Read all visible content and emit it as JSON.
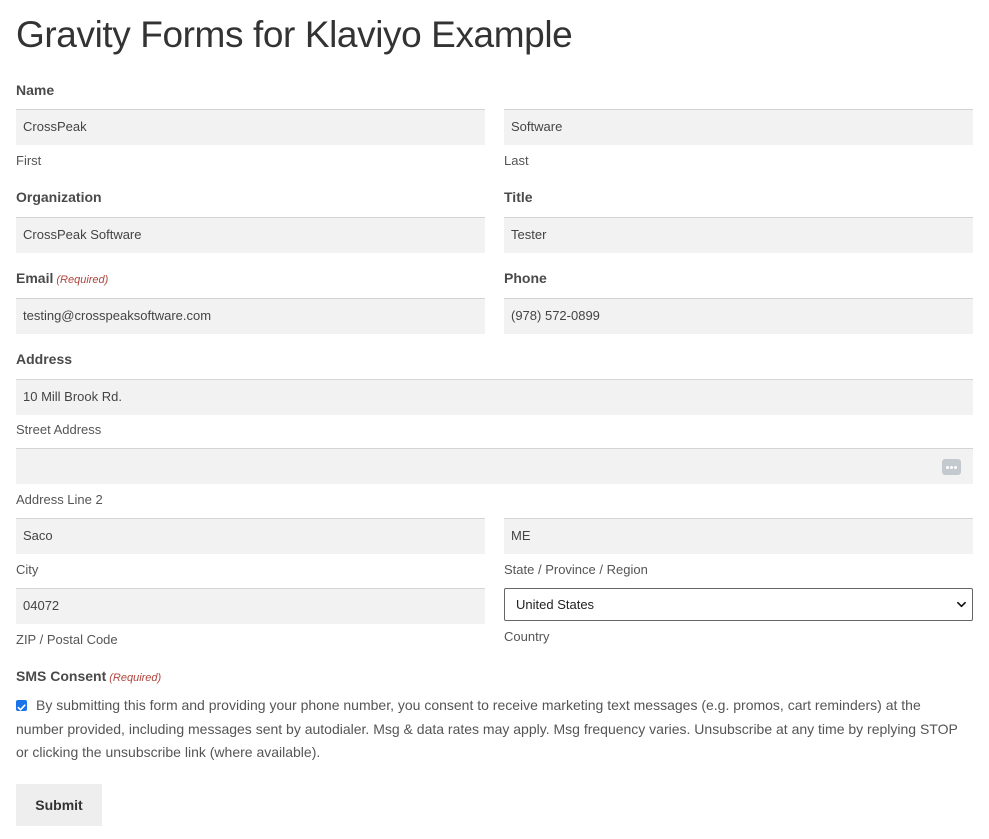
{
  "page": {
    "title": "Gravity Forms for Klaviyo Example"
  },
  "form": {
    "name": {
      "label": "Name",
      "first_value": "CrossPeak",
      "first_sublabel": "First",
      "last_value": "Software",
      "last_sublabel": "Last"
    },
    "organization": {
      "label": "Organization",
      "value": "CrossPeak Software"
    },
    "title_field": {
      "label": "Title",
      "value": "Tester"
    },
    "email": {
      "label": "Email",
      "required_text": "(Required)",
      "value": "testing@crosspeaksoftware.com"
    },
    "phone": {
      "label": "Phone",
      "value": "(978) 572-0899"
    },
    "address": {
      "label": "Address",
      "street_value": "10 Mill Brook Rd.",
      "street_sublabel": "Street Address",
      "line2_value": "",
      "line2_sublabel": "Address Line 2",
      "city_value": "Saco",
      "city_sublabel": "City",
      "state_value": "ME",
      "state_sublabel": "State / Province / Region",
      "zip_value": "04072",
      "zip_sublabel": "ZIP / Postal Code",
      "country_value": "United States",
      "country_sublabel": "Country"
    },
    "sms_consent": {
      "label": "SMS Consent",
      "required_text": "(Required)",
      "checked": true,
      "text": "By submitting this form and providing your phone number, you consent to receive marketing text messages (e.g. promos, cart reminders) at the number provided, including messages sent by autodialer. Msg & data rates may apply. Msg frequency varies. Unsubscribe at any time by replying STOP or clicking the unsubscribe link (where available)."
    },
    "submit_label": "Submit"
  },
  "colors": {
    "required": "#b0453e",
    "input_bg": "#f2f2f2",
    "checkbox": "#1a73e8"
  },
  "icons": {
    "autofill": "more-dots-icon",
    "select": "chevron-down-icon",
    "consent": "checkbox-checked-icon"
  }
}
